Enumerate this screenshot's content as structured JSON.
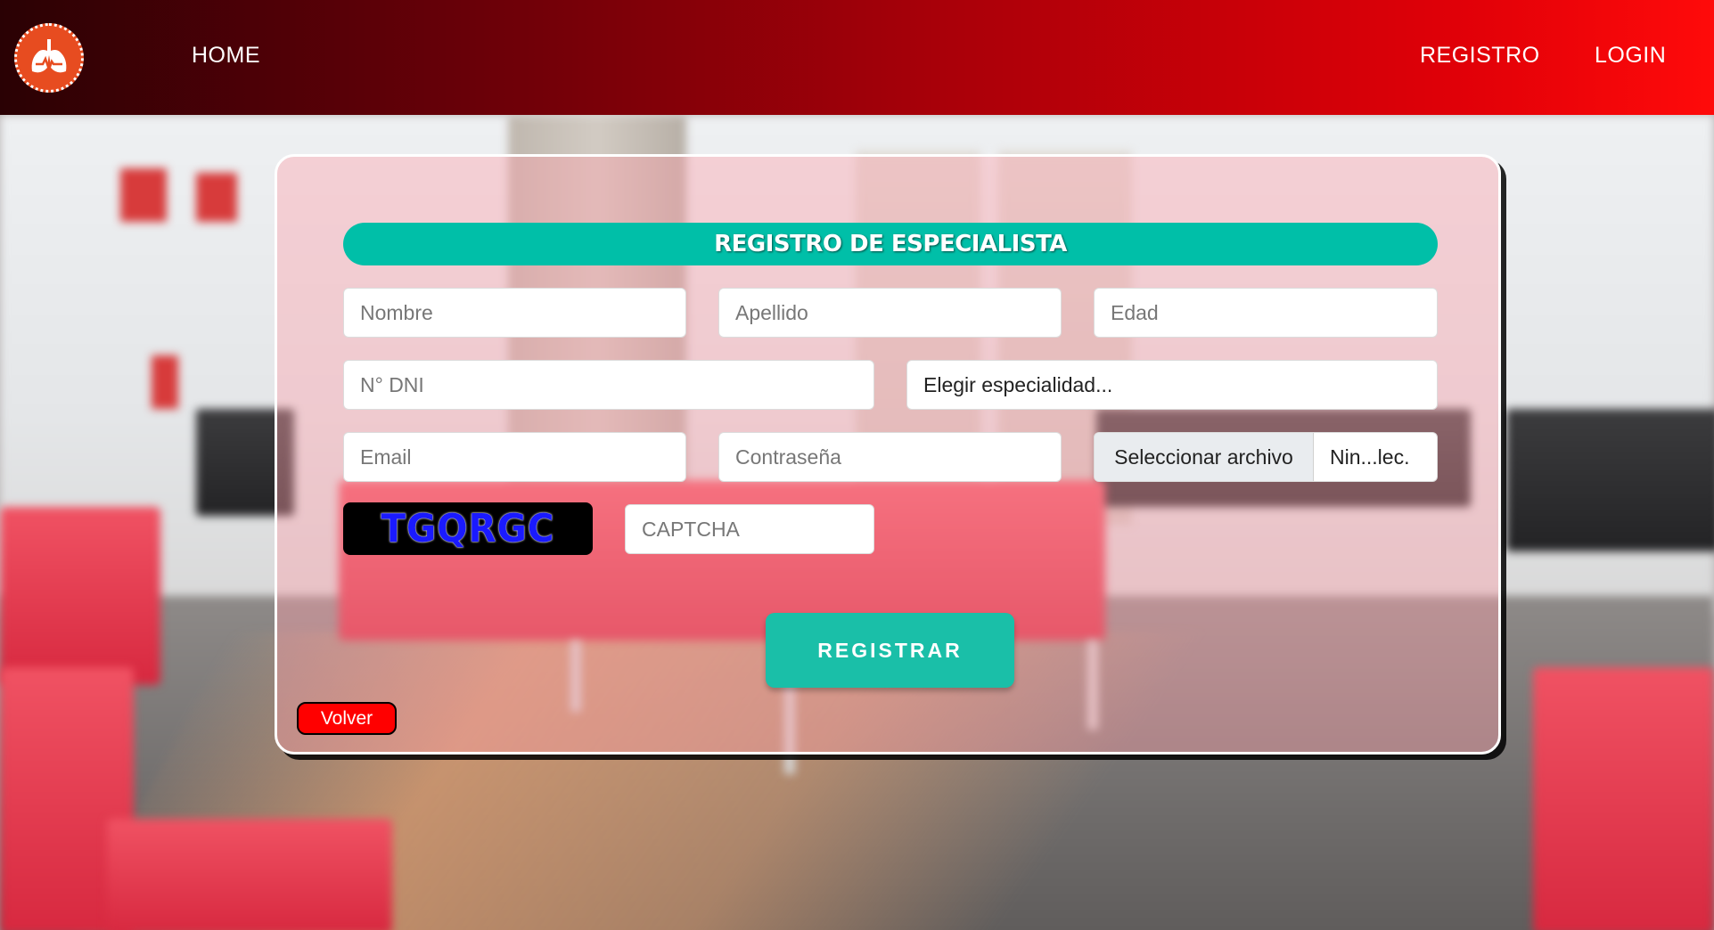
{
  "navbar": {
    "home_label": "HOME",
    "registro_label": "REGISTRO",
    "login_label": "LOGIN",
    "logo_icon": "lungs-heartbeat-icon"
  },
  "form": {
    "title": "REGISTRO DE ESPECIALISTA",
    "nombre_placeholder": "Nombre",
    "apellido_placeholder": "Apellido",
    "edad_placeholder": "Edad",
    "dni_placeholder": "N° DNI",
    "especialidad_selected": "Elegir especialidad...",
    "email_placeholder": "Email",
    "password_placeholder": "Contraseña",
    "file_button_label": "Seleccionar archivo",
    "file_name": "Nin...lec.",
    "captcha_code": "TGQRGC",
    "captcha_placeholder": "CAPTCHA",
    "submit_label": "REGISTRAR",
    "back_label": "Volver"
  },
  "colors": {
    "accent": "#00bfa8",
    "navbar_start": "#2a0104",
    "navbar_end": "#ff0a0a",
    "back_button": "#ff0000",
    "captcha_text": "#1a1aff"
  }
}
